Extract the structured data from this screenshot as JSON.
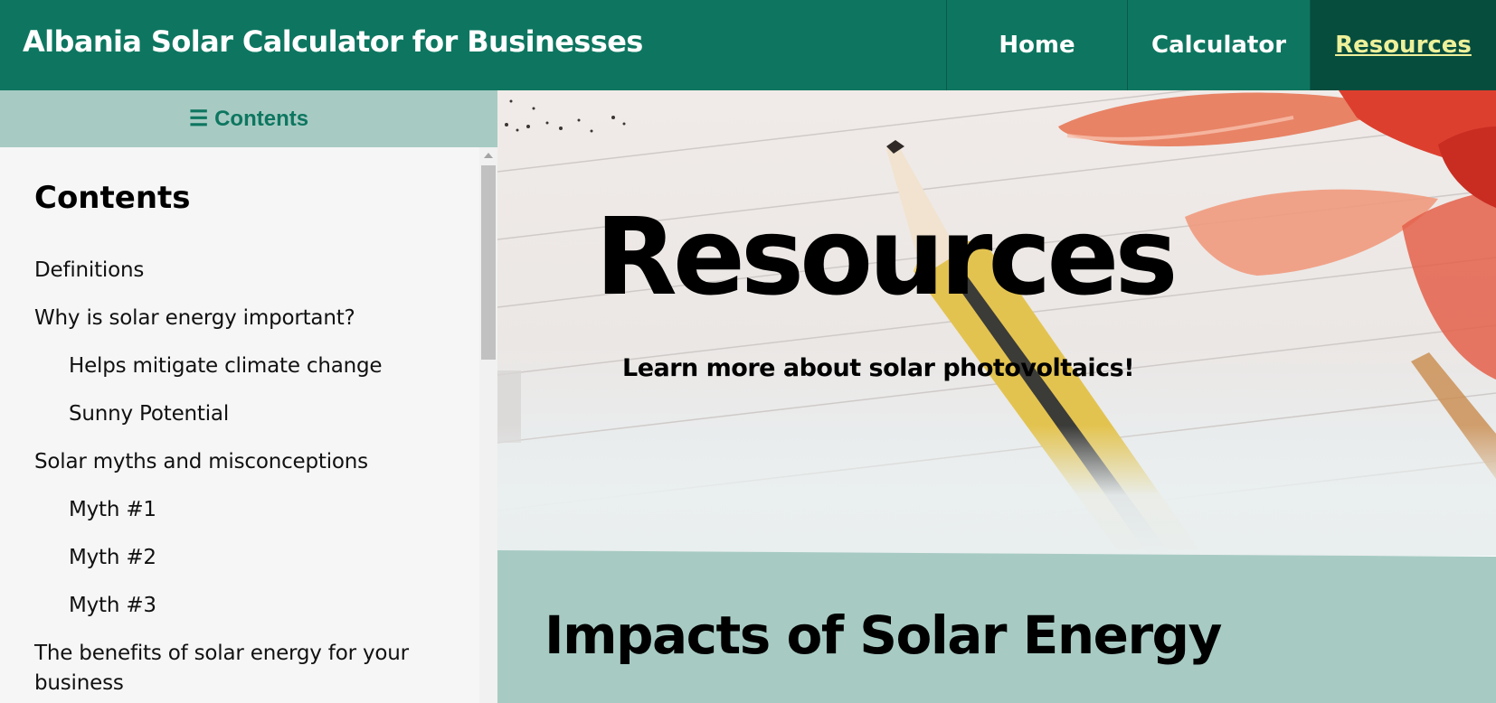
{
  "header": {
    "site_title": "Albania Solar Calculator for Businesses",
    "nav": [
      {
        "label": "Home",
        "active": false
      },
      {
        "label": "Calculator",
        "active": false
      },
      {
        "label": "Resources",
        "active": true
      }
    ]
  },
  "sidebar": {
    "toggle_icon": "hamburger-icon",
    "toggle_label": "☰ Contents",
    "heading": "Contents",
    "items": [
      {
        "label": "Definitions",
        "level": 1
      },
      {
        "label": "Why is solar energy important?",
        "level": 1
      },
      {
        "label": "Helps mitigate climate change",
        "level": 2
      },
      {
        "label": "Sunny Potential",
        "level": 2
      },
      {
        "label": "Solar myths and misconceptions",
        "level": 1
      },
      {
        "label": "Myth #1",
        "level": 2
      },
      {
        "label": "Myth #2",
        "level": 2
      },
      {
        "label": "Myth #3",
        "level": 2
      },
      {
        "label": "The benefits of solar energy for your business",
        "level": 1
      }
    ]
  },
  "hero": {
    "title": "Resources",
    "subtitle": "Learn more about solar photovoltaics!"
  },
  "section": {
    "title": "Impacts of Solar Energy"
  },
  "colors": {
    "brand_green": "#0e7660",
    "active_nav_bg": "#064d3d",
    "active_nav_text": "#eef09a",
    "accent_mint": "#a7cbc3",
    "sidebar_bg": "#f6f6f6"
  }
}
